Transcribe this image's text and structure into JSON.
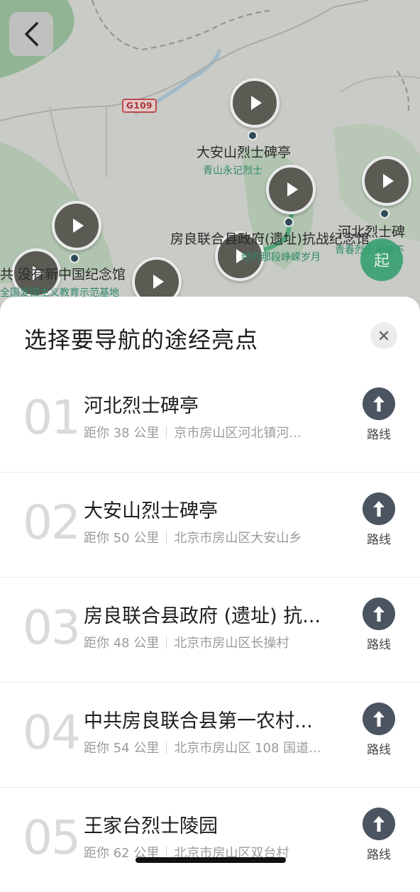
{
  "map": {
    "road_badge": "G109",
    "labels": {
      "dashan_main": "大安山烈士碑亭",
      "dashan_sub": "青山永记烈士",
      "hebei_main": "河北烈士碑",
      "hebei_sub": "青春烈士永垂不",
      "fangliang_main": "房良联合县政府(遗址)抗战纪念馆",
      "fangliang_sub": "经的那段峥嵘岁月",
      "left_main": "共         没有新中国纪念馆",
      "left_sub": "全国爱国主义教育示范基地"
    },
    "start_badge": "起"
  },
  "sheet": {
    "title": "选择要导航的途经亮点",
    "route_label": "路线",
    "items": [
      {
        "index": "01",
        "name": "河北烈士碑亭",
        "distance": "距你 38 公里",
        "address": "京市房山区河北镇河..."
      },
      {
        "index": "02",
        "name": "大安山烈士碑亭",
        "distance": "距你 50 公里",
        "address": "北京市房山区大安山乡"
      },
      {
        "index": "03",
        "name": "房良联合县政府 (遗址) 抗...",
        "distance": "距你 48 公里",
        "address": "北京市房山区长操村"
      },
      {
        "index": "04",
        "name": "中共房良联合县第一农村...",
        "distance": "距你 54 公里",
        "address": "北京市房山区 108 国道..."
      },
      {
        "index": "05",
        "name": "王家台烈士陵园",
        "distance": "距你 62 公里",
        "address": "北京市房山区双台村"
      }
    ]
  },
  "colors": {
    "accent_green": "#2e9e6b",
    "route_icon_bg": "#4b5461",
    "index_gray": "#d9dadb"
  }
}
